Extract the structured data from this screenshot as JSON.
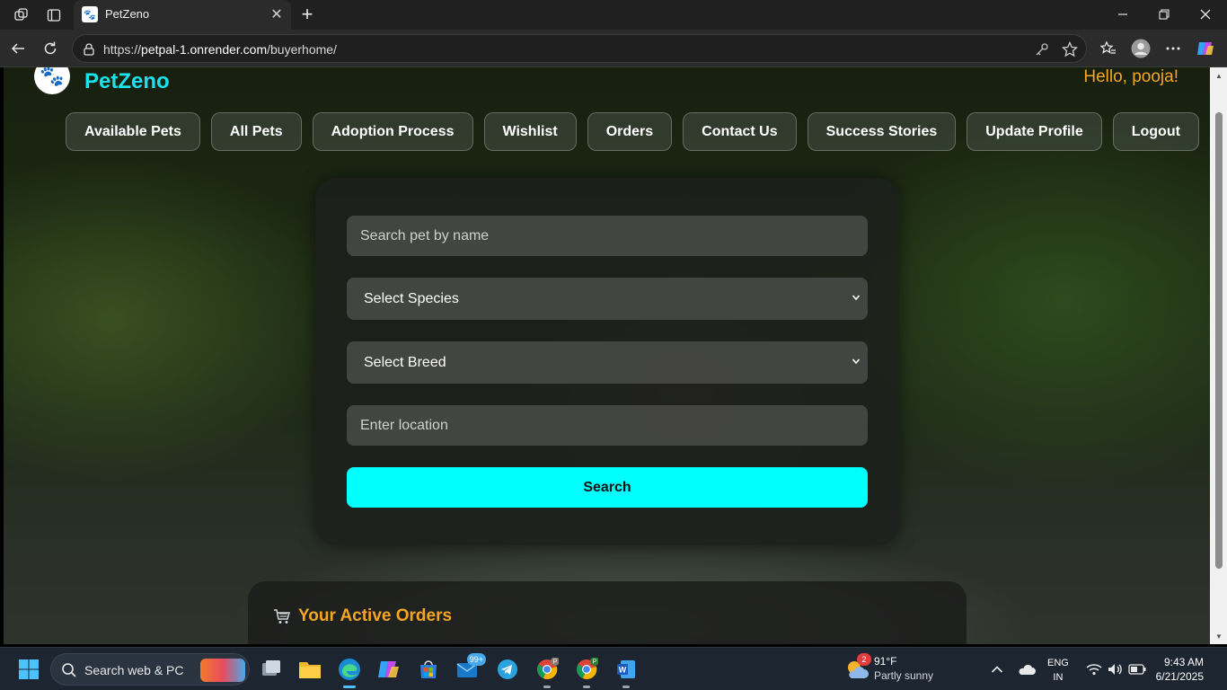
{
  "browser": {
    "tab_title": "PetZeno",
    "url_prefix": "https://",
    "url_host": "petpal-1.onrender.com",
    "url_path": "/buyerhome/"
  },
  "page": {
    "brand": "PetZeno",
    "greeting": "Hello, pooja!",
    "accent_color": "#00ffff",
    "greeting_color": "#f5a623",
    "nav": [
      {
        "label": "Available Pets"
      },
      {
        "label": "All Pets"
      },
      {
        "label": "Adoption Process"
      },
      {
        "label": "Wishlist"
      },
      {
        "label": "Orders"
      },
      {
        "label": "Contact Us"
      },
      {
        "label": "Success Stories"
      },
      {
        "label": "Update Profile"
      },
      {
        "label": "Logout"
      }
    ],
    "search": {
      "name_placeholder": "Search pet by name",
      "species_selected": "Select Species",
      "breed_selected": "Select Breed",
      "location_placeholder": "Enter location",
      "button_label": "Search"
    },
    "orders": {
      "title": "Your Active Orders",
      "icon": "shopping-cart-icon"
    }
  },
  "taskbar": {
    "search_placeholder": "Search web & PC",
    "store_badge": "99+",
    "weather_badge": "2",
    "weather_temp": "91°F",
    "weather_desc": "Partly sunny",
    "lang_line1": "ENG",
    "lang_line2": "IN",
    "time": "9:43 AM",
    "date": "6/21/2025"
  }
}
